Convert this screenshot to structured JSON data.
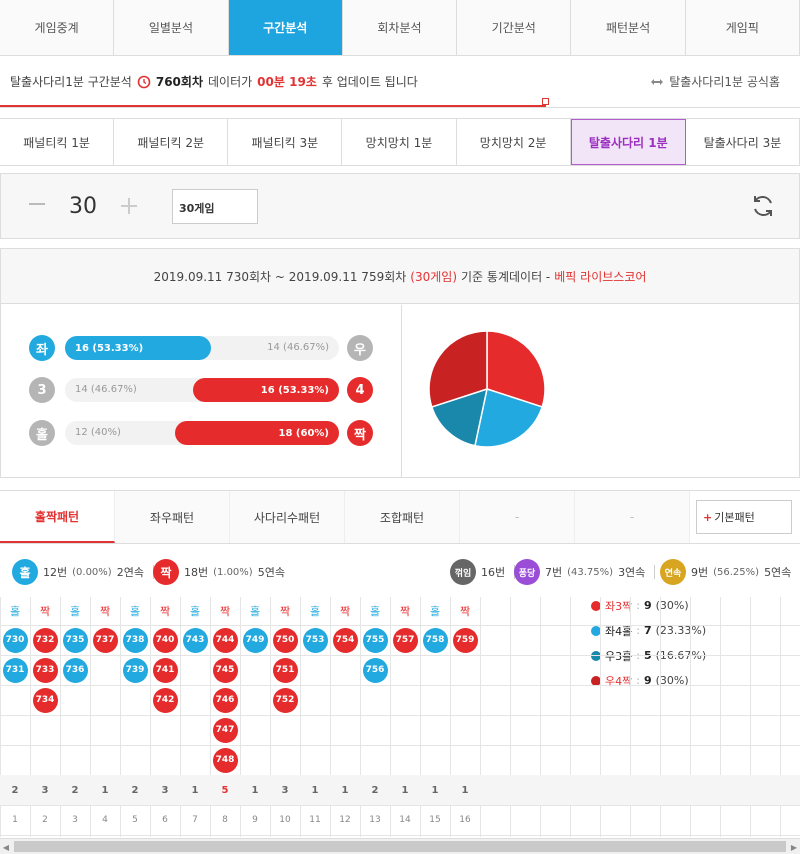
{
  "top_tabs": [
    {
      "label": "게임중계",
      "active": false
    },
    {
      "label": "일별분석",
      "active": false
    },
    {
      "label": "구간분석",
      "active": true
    },
    {
      "label": "회차분석",
      "active": false
    },
    {
      "label": "기간분석",
      "active": false
    },
    {
      "label": "패턴분석",
      "active": false
    },
    {
      "label": "게임픽",
      "active": false
    }
  ],
  "info": {
    "prefix": "탈출사다리1분 구간분석",
    "round": "760회차",
    "mid": "데이터가",
    "time": "00분 19초",
    "suffix": "후 업데이트 됩니다",
    "official": "탈출사다리1분 공식홈"
  },
  "game_tabs": [
    {
      "label": "패널티킥 1분",
      "active": false
    },
    {
      "label": "패널티킥 2분",
      "active": false
    },
    {
      "label": "패널티킥 3분",
      "active": false
    },
    {
      "label": "망치망치 1분",
      "active": false
    },
    {
      "label": "망치망치 2분",
      "active": false
    },
    {
      "label": "탈출사다리 1분",
      "active": true
    },
    {
      "label": "탈출사다리 3분",
      "active": false
    }
  ],
  "counter": {
    "value": "30",
    "select": "30게임"
  },
  "stats_header": {
    "range": "2019.09.11 730회차 ~ 2019.09.11 759회차",
    "games": "(30게임)",
    "basis": "기준 통계데이터 -",
    "source": "베픽 라이브스코어"
  },
  "stat_rows": [
    {
      "left": "좌",
      "right": "우",
      "left_text": "16 (53.33%)",
      "right_text": "14 (46.67%)",
      "left_pct": 53.33,
      "winner": "left",
      "left_color": "#22a9df",
      "right_color": "#b5b5b5"
    },
    {
      "left": "3",
      "right": "4",
      "left_text": "14 (46.67%)",
      "right_text": "16 (53.33%)",
      "left_pct": 46.67,
      "winner": "right",
      "left_color": "#b5b5b5",
      "right_color": "#e52b2b"
    },
    {
      "left": "홀",
      "right": "짝",
      "left_text": "12 (40%)",
      "right_text": "18 (60%)",
      "left_pct": 40,
      "winner": "right",
      "left_color": "#b5b5b5",
      "right_color": "#e52b2b"
    }
  ],
  "pie": [
    {
      "label": "좌3짝",
      "value": "9",
      "pct": "(30%)",
      "count": 9,
      "color": "#e52b2b",
      "red_label": true
    },
    {
      "label": "좌4홀",
      "value": "7",
      "pct": "(23.33%)",
      "count": 7,
      "color": "#22a9df",
      "red_label": false
    },
    {
      "label": "우3홀",
      "value": "5",
      "pct": "(16.67%)",
      "count": 5,
      "color": "#1a88ab",
      "red_label": false
    },
    {
      "label": "우4짝",
      "value": "9",
      "pct": "(30%)",
      "count": 9,
      "color": "#c92222",
      "red_label": true
    }
  ],
  "pattern_tabs": [
    {
      "label": "홀짝패턴",
      "state": "active"
    },
    {
      "label": "좌우패턴",
      "state": ""
    },
    {
      "label": "사다리수패턴",
      "state": ""
    },
    {
      "label": "조합패턴",
      "state": ""
    },
    {
      "label": "-",
      "state": "dim"
    },
    {
      "label": "-",
      "state": "dim"
    }
  ],
  "basic_pattern": {
    "plus": "+",
    "label": "기본패턴"
  },
  "summary": {
    "odd": {
      "icon": "홀",
      "a": "12번",
      "b": "(0.00%)",
      "c": "2연속"
    },
    "even": {
      "icon": "짝",
      "a": "18번",
      "b": "(1.00%)",
      "c": "5연속"
    },
    "break": {
      "icon": "꺾임",
      "a": "16번"
    },
    "pong": {
      "icon": "퐁당",
      "a": "7번",
      "b": "(43.75%)",
      "c": "3연속"
    },
    "streak": {
      "icon": "연속",
      "a": "9번",
      "b": "(56.25%)",
      "c": "5연속"
    }
  },
  "columns": [
    {
      "head": "홀",
      "type": "odd",
      "items": [
        "730",
        "731"
      ],
      "count": "2",
      "idx": "1"
    },
    {
      "head": "짝",
      "type": "even",
      "items": [
        "732",
        "733",
        "734"
      ],
      "count": "3",
      "idx": "2"
    },
    {
      "head": "홀",
      "type": "odd",
      "items": [
        "735",
        "736"
      ],
      "count": "2",
      "idx": "3"
    },
    {
      "head": "짝",
      "type": "even",
      "items": [
        "737"
      ],
      "count": "1",
      "idx": "4"
    },
    {
      "head": "홀",
      "type": "odd",
      "items": [
        "738",
        "739"
      ],
      "count": "2",
      "idx": "5"
    },
    {
      "head": "짝",
      "type": "even",
      "items": [
        "740",
        "741",
        "742"
      ],
      "count": "3",
      "idx": "6"
    },
    {
      "head": "홀",
      "type": "odd",
      "items": [
        "743"
      ],
      "count": "1",
      "idx": "7"
    },
    {
      "head": "짝",
      "type": "even",
      "items": [
        "744",
        "745",
        "746",
        "747",
        "748"
      ],
      "count": "5",
      "idx": "8"
    },
    {
      "head": "홀",
      "type": "odd",
      "items": [
        "749"
      ],
      "count": "1",
      "idx": "9"
    },
    {
      "head": "짝",
      "type": "even",
      "items": [
        "750",
        "751",
        "752"
      ],
      "count": "3",
      "idx": "10"
    },
    {
      "head": "홀",
      "type": "odd",
      "items": [
        "753"
      ],
      "count": "1",
      "idx": "11"
    },
    {
      "head": "짝",
      "type": "even",
      "items": [
        "754"
      ],
      "count": "1",
      "idx": "12"
    },
    {
      "head": "홀",
      "type": "odd",
      "items": [
        "755",
        "756"
      ],
      "count": "2",
      "idx": "13"
    },
    {
      "head": "짝",
      "type": "even",
      "items": [
        "757"
      ],
      "count": "1",
      "idx": "14"
    },
    {
      "head": "홀",
      "type": "odd",
      "items": [
        "758"
      ],
      "count": "1",
      "idx": "15"
    },
    {
      "head": "짝",
      "type": "even",
      "items": [
        "759"
      ],
      "count": "1",
      "idx": "16"
    }
  ],
  "colors": {
    "odd": "#22a9df",
    "even": "#e52b2b",
    "accent": "#1ea5e0"
  }
}
